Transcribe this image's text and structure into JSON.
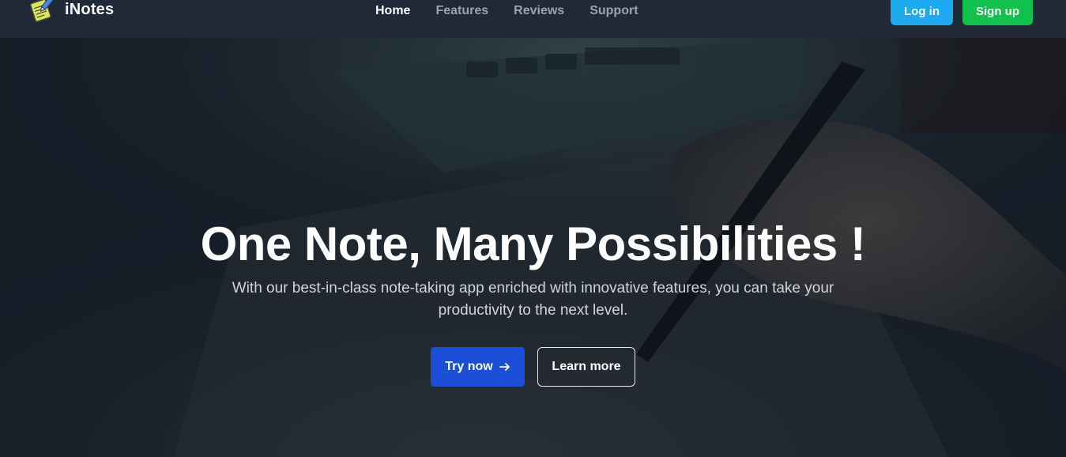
{
  "brand": {
    "name": "iNotes",
    "logo_icon": "notepad-pencil-icon"
  },
  "nav": {
    "links": [
      {
        "label": "Home",
        "active": true
      },
      {
        "label": "Features",
        "active": false
      },
      {
        "label": "Reviews",
        "active": false
      },
      {
        "label": "Support",
        "active": false
      }
    ]
  },
  "auth": {
    "login_label": "Log in",
    "signup_label": "Sign up"
  },
  "hero": {
    "title": "One Note, Many Possibilities !",
    "subtitle": "With our best-in-class note-taking app enriched with innovative features, you can take your productivity to the next level.",
    "primary_cta": "Try now",
    "primary_cta_icon": "arrow-right-icon",
    "secondary_cta": "Learn more",
    "background_icon": "hand-writing-on-tablet-photo"
  },
  "colors": {
    "navbar_bg": "#1f2937",
    "login_bg": "#1eaaf1",
    "signup_bg": "#0ec24d",
    "try_bg": "#1d4ed8",
    "nav_inactive": "#9ca3af",
    "hero_text": "#ffffff"
  }
}
